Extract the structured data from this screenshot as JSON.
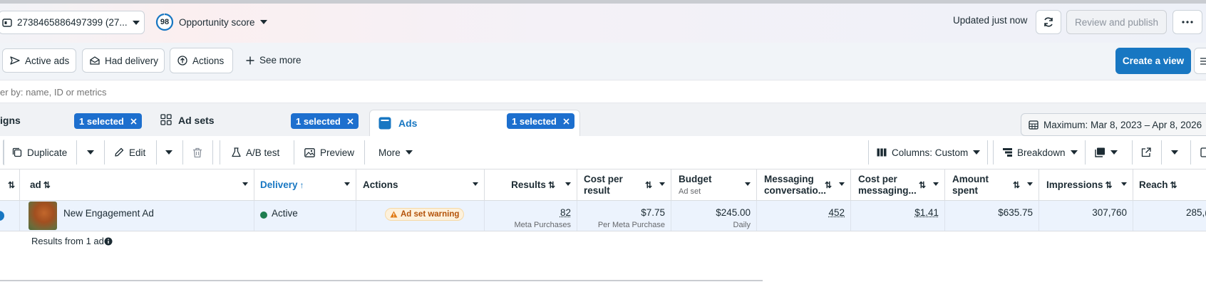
{
  "header": {
    "account_label": "2738465886497399 (27...",
    "opportunity_score": "98",
    "opportunity_label": "Opportunity score",
    "updated_text": "Updated just now",
    "review_publish_label": "Review and publish"
  },
  "filters": {
    "active_ads_label": "Active ads",
    "had_delivery_label": "Had delivery",
    "actions_label": "Actions",
    "see_more_label": "See more",
    "create_view_label": "Create a view",
    "search_placeholder": "er by: name, ID or metrics"
  },
  "tabs": {
    "campaigns": {
      "label": "igns",
      "selected": "1 selected"
    },
    "ad_sets": {
      "label": "Ad sets",
      "selected": "1 selected"
    },
    "ads": {
      "label": "Ads",
      "selected": "1 selected"
    },
    "date_range": "Maximum: Mar 8, 2023 – Apr 8, 2026"
  },
  "toolbar": {
    "duplicate_label": "Duplicate",
    "edit_label": "Edit",
    "ab_test_label": "A/B test",
    "preview_label": "Preview",
    "more_label": "More",
    "columns_label": "Columns: Custom",
    "breakdown_label": "Breakdown"
  },
  "table": {
    "columns": {
      "ad": "ad",
      "delivery": "Delivery",
      "actions": "Actions",
      "results": "Results",
      "cost_per_result_1": "Cost per",
      "cost_per_result_2": "result",
      "budget": "Budget",
      "budget_sub": "Ad set",
      "messaging_1": "Messaging",
      "messaging_2": "conversatio...",
      "cost_messaging_1": "Cost per",
      "cost_messaging_2": "messaging...",
      "amount_1": "Amount",
      "amount_2": "spent",
      "impressions": "Impressions",
      "reach": "Reach"
    },
    "row": {
      "ad_name": "New Engagement Ad",
      "delivery": "Active",
      "warning": "Ad set warning",
      "results": "82",
      "results_sub": "Meta Purchases",
      "cost_per_result": "$7.75",
      "cost_per_result_sub": "Per Meta Purchase",
      "budget": "$245.00",
      "budget_sub": "Daily",
      "messaging": "452",
      "cost_messaging": "$1.41",
      "amount_spent": "$635.75",
      "impressions": "307,760",
      "reach": "285,("
    },
    "footer": "Results from 1 ad"
  },
  "colors": {
    "primary": "#1877c2",
    "active_dot": "#1e7d4f",
    "warning_bg": "#fdf1dc",
    "warning_text": "#b4530a"
  }
}
